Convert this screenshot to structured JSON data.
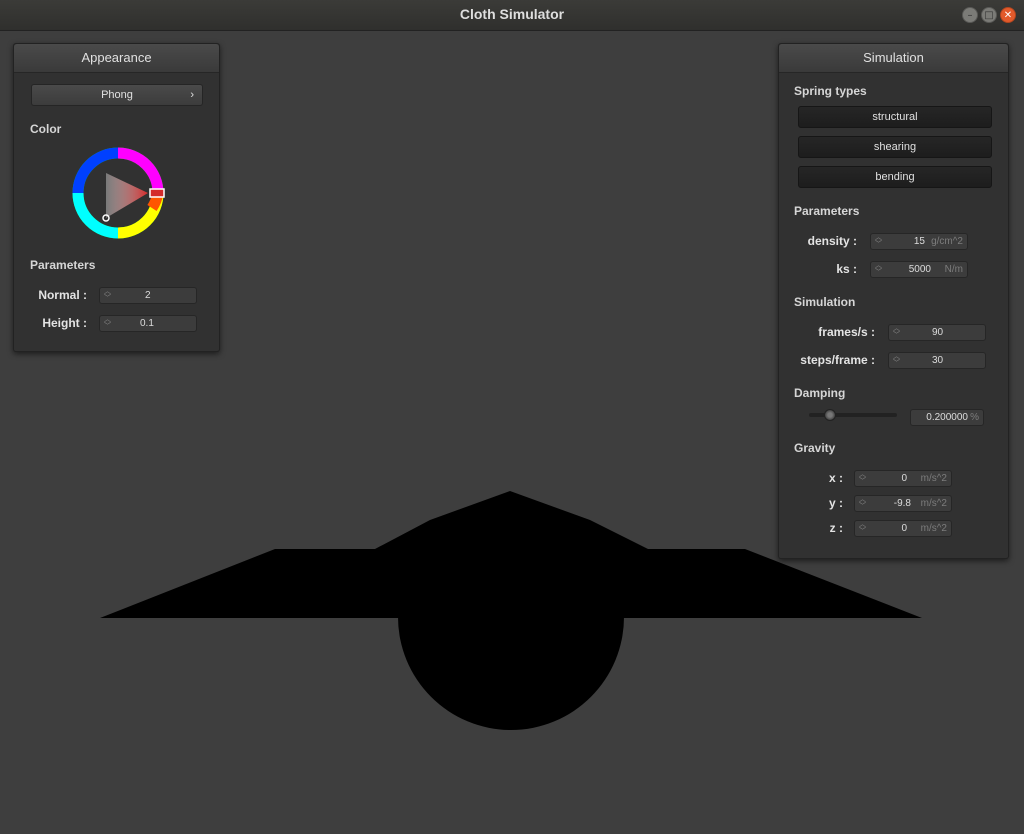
{
  "window": {
    "title": "Cloth Simulator",
    "minimize_icon": "minimize-icon",
    "maximize_icon": "maximize-icon",
    "close_icon": "close-icon"
  },
  "appearance": {
    "header": "Appearance",
    "shader": "Phong",
    "color_label": "Color",
    "color": "#d42a2a",
    "params_label": "Parameters",
    "normal_label": "Normal :",
    "normal_value": "2",
    "height_label": "Height :",
    "height_value": "0.1"
  },
  "simulation": {
    "header": "Simulation",
    "spring_types_label": "Spring types",
    "springs": [
      "structural",
      "shearing",
      "bending"
    ],
    "params_label": "Parameters",
    "density_label": "density :",
    "density_value": "15",
    "density_unit": "g/cm^2",
    "ks_label": "ks :",
    "ks_value": "5000",
    "ks_unit": "N/m",
    "sim_label": "Simulation",
    "fps_label": "frames/s :",
    "fps_value": "90",
    "steps_label": "steps/frame :",
    "steps_value": "30",
    "damping_label": "Damping",
    "damping_value": "0.200000",
    "damping_unit": "%",
    "damping_fraction": 0.2,
    "gravity_label": "Gravity",
    "gx_label": "x :",
    "gx_value": "0",
    "gy_label": "y :",
    "gy_value": "-9.8",
    "gz_label": "z :",
    "gz_value": "0",
    "g_unit": "m/s^2"
  }
}
